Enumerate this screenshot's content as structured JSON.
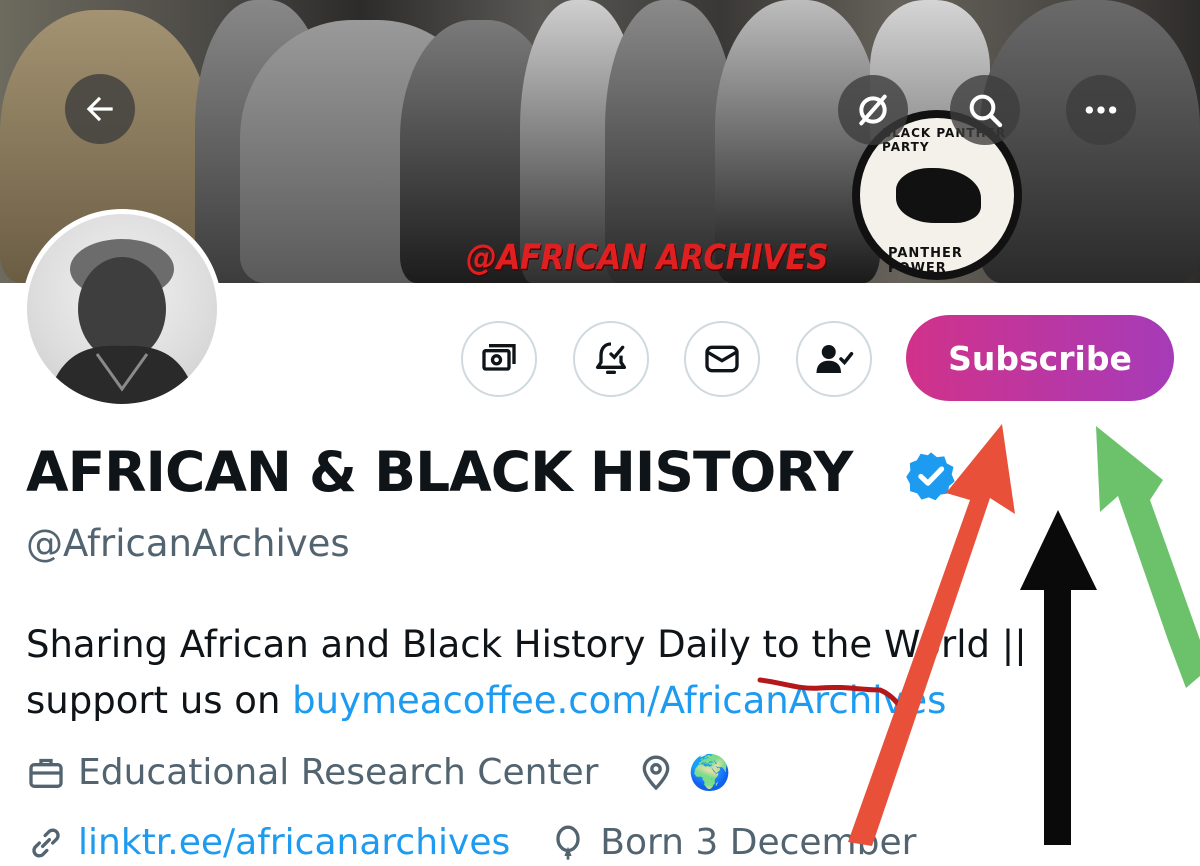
{
  "banner": {
    "watermark": "@AFRICAN ARCHIVES",
    "logo_top": "BLACK PANTHER PARTY",
    "logo_bottom": "PANTHER POWER"
  },
  "nav": {
    "back_icon": "arrow-left-icon",
    "grok_icon": "grok-icon",
    "search_icon": "search-icon",
    "more_icon": "more-horizontal-icon"
  },
  "actions": {
    "tip_icon": "money-icon",
    "notify_icon": "bell-check-icon",
    "message_icon": "mail-icon",
    "follow_icon": "user-check-icon",
    "subscribe_label": "Subscribe"
  },
  "profile": {
    "display_name": "AFRICAN & BLACK HISTORY",
    "handle": "@AfricanArchives",
    "bio_text": "Sharing African and Black History Daily to the World || support us on ",
    "bio_link": "buymeacoffee.com/AfricanArchives",
    "category": "Educational Research Center",
    "location_emoji": "🌍",
    "website": "linktr.ee/africanarchives",
    "birthday": "Born 3 December"
  },
  "colors": {
    "accent": "#1d9bf0",
    "subscribe_start": "#d1328a",
    "subscribe_end": "#a63bb8",
    "verified": "#1d9bf0",
    "annotation_red": "#e8503a",
    "annotation_black": "#0a0a0a",
    "annotation_green": "#6cc26a"
  }
}
